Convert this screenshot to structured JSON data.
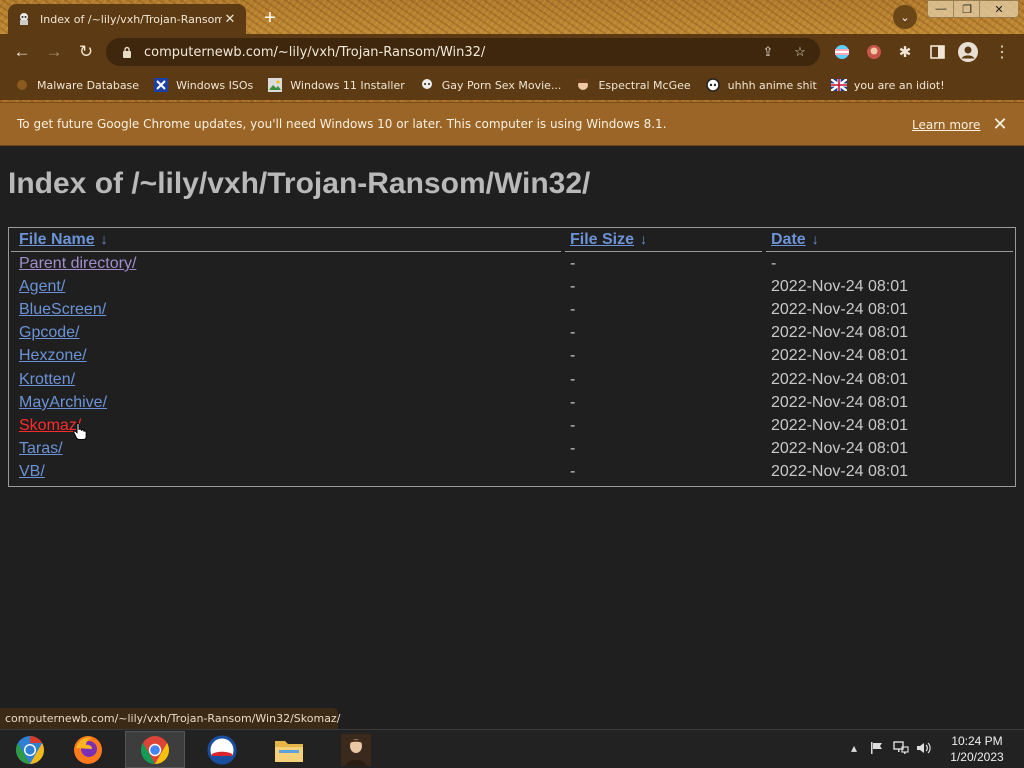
{
  "window": {
    "tab_title": "Index of /~lily/vxh/Trojan-Ransom/Win32/",
    "url": "computernewb.com/~lily/vxh/Trojan-Ransom/Win32/"
  },
  "bookmarks": [
    {
      "label": "Malware Database",
      "icon": "malware-icon"
    },
    {
      "label": "Windows ISOs",
      "icon": "x-icon"
    },
    {
      "label": "Windows 11 Installer",
      "icon": "image-icon"
    },
    {
      "label": "Gay Porn Sex Movie...",
      "icon": "character-icon"
    },
    {
      "label": "Espectral McGee",
      "icon": "character-icon"
    },
    {
      "label": "uhhh anime shit",
      "icon": "anime-icon"
    },
    {
      "label": "you are an idiot!",
      "icon": "flag-icon"
    }
  ],
  "infobar": {
    "message": "To get future Google Chrome updates, you'll need Windows 10 or later. This computer is using Windows 8.1.",
    "link": "Learn more"
  },
  "page": {
    "heading": "Index of /~lily/vxh/Trojan-Ransom/Win32/",
    "columns": {
      "name": "File Name",
      "size": "File Size",
      "date": "Date",
      "sort_glyph": "↓"
    },
    "rows": [
      {
        "name": "Parent directory/",
        "size": "-",
        "date": "-"
      },
      {
        "name": "Agent/",
        "size": "-",
        "date": "2022-Nov-24 08:01"
      },
      {
        "name": "BlueScreen/",
        "size": "-",
        "date": "2022-Nov-24 08:01"
      },
      {
        "name": "Gpcode/",
        "size": "-",
        "date": "2022-Nov-24 08:01"
      },
      {
        "name": "Hexzone/",
        "size": "-",
        "date": "2022-Nov-24 08:01"
      },
      {
        "name": "Krotten/",
        "size": "-",
        "date": "2022-Nov-24 08:01"
      },
      {
        "name": "MayArchive/",
        "size": "-",
        "date": "2022-Nov-24 08:01"
      },
      {
        "name": "Skomaz/",
        "size": "-",
        "date": "2022-Nov-24 08:01"
      },
      {
        "name": "Taras/",
        "size": "-",
        "date": "2022-Nov-24 08:01"
      },
      {
        "name": "VB/",
        "size": "-",
        "date": "2022-Nov-24 08:01"
      }
    ]
  },
  "status_url": "computernewb.com/~lily/vxh/Trojan-Ransom/Win32/Skomaz/",
  "taskbar": {
    "time": "10:24 PM",
    "date": "1/20/2023"
  },
  "colors": {
    "link": "#6b93d6",
    "visited": "#a28ecb",
    "hover": "#ff2b2b",
    "page_bg": "#1f1f1f",
    "infobar_bg": "#9a6527"
  }
}
